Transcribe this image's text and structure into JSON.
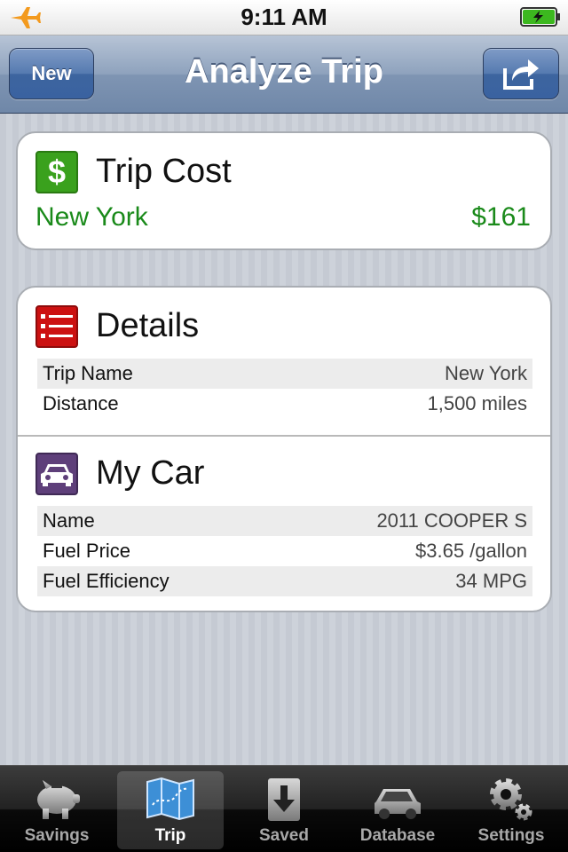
{
  "status_bar": {
    "time": "9:11 AM"
  },
  "nav": {
    "new_label": "New",
    "title": "Analyze Trip"
  },
  "trip_cost": {
    "title": "Trip Cost",
    "city": "New York",
    "amount": "$161",
    "icon_symbol": "$"
  },
  "details": {
    "title": "Details",
    "rows": [
      {
        "label": "Trip Name",
        "value": "New York"
      },
      {
        "label": "Distance",
        "value": "1,500 miles"
      }
    ]
  },
  "car": {
    "title": "My Car",
    "rows": [
      {
        "label": "Name",
        "value": "2011 COOPER S"
      },
      {
        "label": "Fuel Price",
        "value": "$3.65 /gallon"
      },
      {
        "label": "Fuel Efficiency",
        "value": "34 MPG"
      }
    ]
  },
  "tabs": [
    {
      "label": "Savings",
      "icon": "piggy-bank-icon"
    },
    {
      "label": "Trip",
      "icon": "map-icon",
      "active": true
    },
    {
      "label": "Saved",
      "icon": "download-icon"
    },
    {
      "label": "Database",
      "icon": "car-icon"
    },
    {
      "label": "Settings",
      "icon": "gear-icon"
    }
  ],
  "colors": {
    "accent_green": "#1a8a1a",
    "details_red": "#cc1111",
    "car_purple": "#5e3f7a"
  }
}
